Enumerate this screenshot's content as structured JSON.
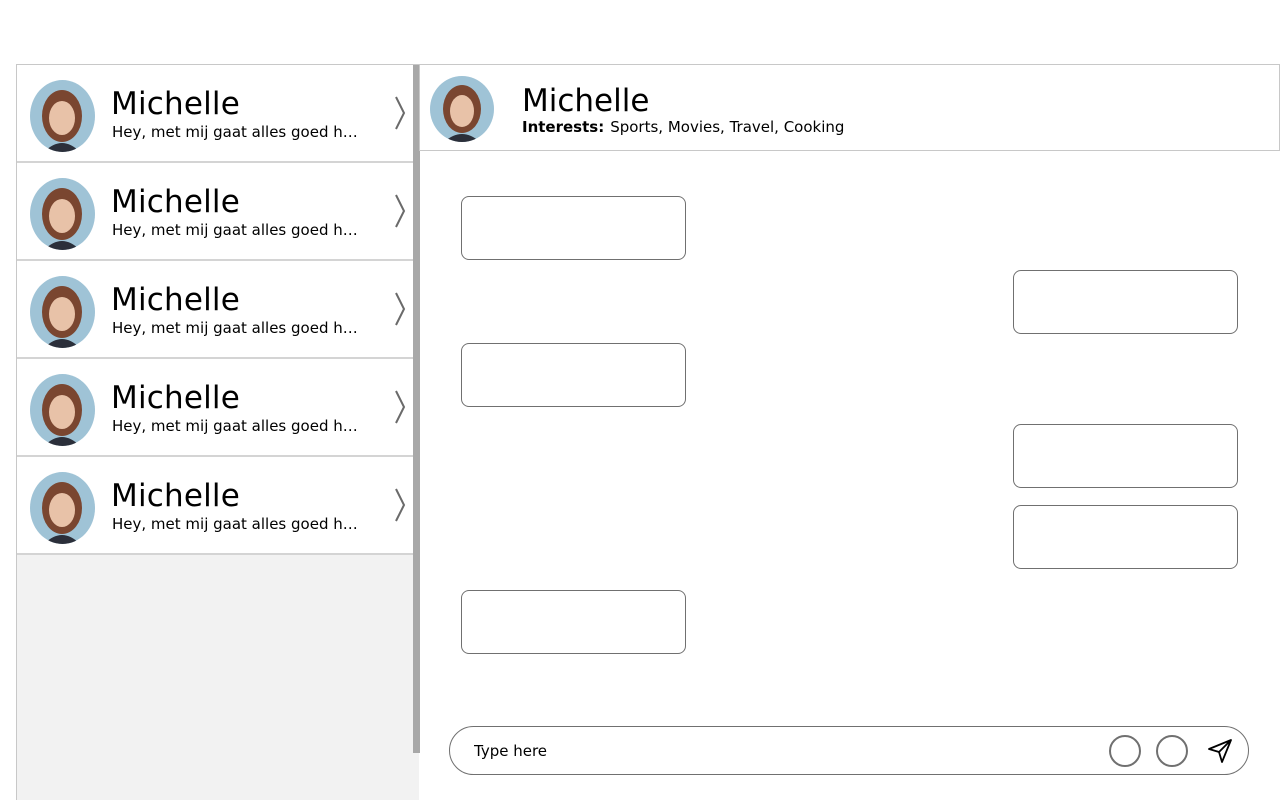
{
  "contacts": [
    {
      "name": "Michelle",
      "preview": "Hey, met mij gaat alles goed hoor..."
    },
    {
      "name": "Michelle",
      "preview": "Hey, met mij gaat alles goed hoor..."
    },
    {
      "name": "Michelle",
      "preview": "Hey, met mij gaat alles goed hoor..."
    },
    {
      "name": "Michelle",
      "preview": "Hey, met mij gaat alles goed hoor..."
    },
    {
      "name": "Michelle",
      "preview": "Hey, met mij gaat alles goed hoor..."
    }
  ],
  "chat": {
    "name": "Michelle",
    "interests_label": "Interests:",
    "interests": "Sports, Movies, Travel, Cooking",
    "messages": [
      {
        "side": "left"
      },
      {
        "side": "right"
      },
      {
        "side": "left"
      },
      {
        "side": "right"
      },
      {
        "side": "right"
      },
      {
        "side": "left"
      }
    ]
  },
  "composer": {
    "placeholder": "Type here"
  },
  "icons": {
    "chevron": "chevron-right-icon",
    "send": "send-icon",
    "action_1": "circle-icon",
    "action_2": "circle-icon"
  }
}
